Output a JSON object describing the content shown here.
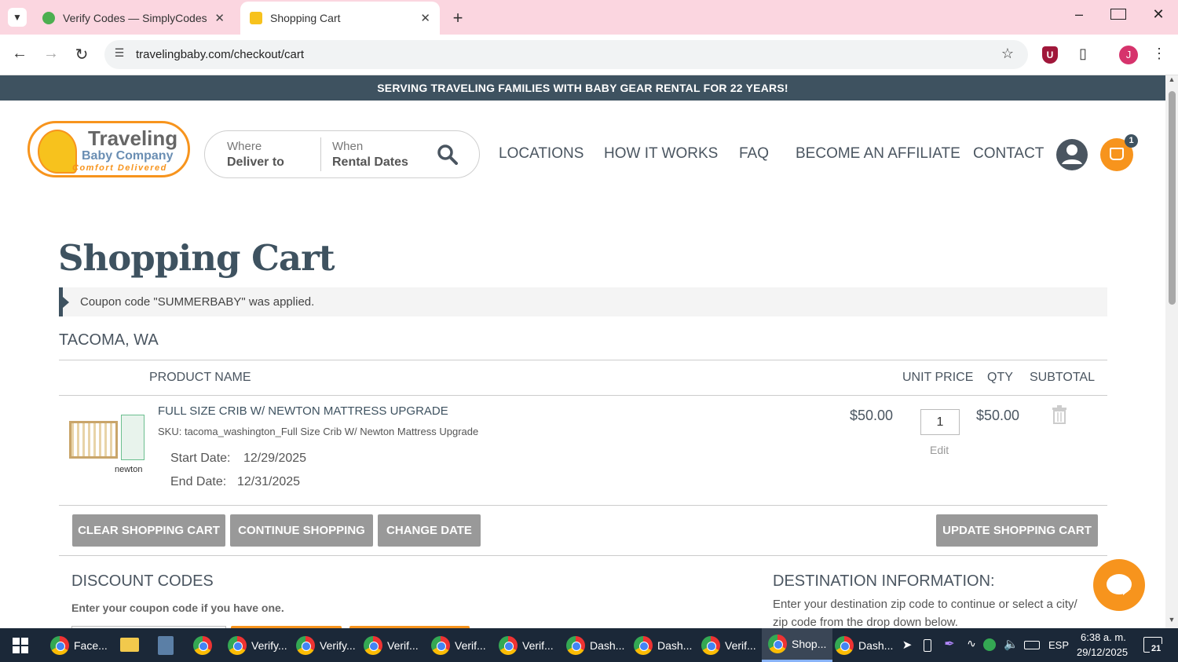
{
  "browser": {
    "tabs": [
      {
        "title": "Verify Codes — SimplyCodes"
      },
      {
        "title": "Shopping Cart"
      }
    ],
    "url": "travelingbaby.com/checkout/cart",
    "profile_initial": "J"
  },
  "site": {
    "banner": "SERVING TRAVELING FAMILIES WITH BABY GEAR RENTAL FOR 22 YEARS!",
    "logo": {
      "line1": "Traveling",
      "line2": "Baby Company",
      "line3": "Comfort Delivered"
    },
    "search": {
      "where_label": "Where",
      "where_value": "Deliver to",
      "when_label": "When",
      "when_value": "Rental Dates"
    },
    "nav": [
      "LOCATIONS",
      "HOW IT WORKS",
      "FAQ",
      "BECOME AN AFFILIATE",
      "CONTACT"
    ],
    "cart_count": "1"
  },
  "cart": {
    "title": "Shopping Cart",
    "notice": "Coupon code \"SUMMERBABY\" was applied.",
    "location": "TACOMA, WA",
    "headers": {
      "product": "PRODUCT NAME",
      "unit_price": "UNIT PRICE",
      "qty": "QTY",
      "subtotal": "SUBTOTAL"
    },
    "item": {
      "name": "FULL SIZE CRIB W/ NEWTON MATTRESS UPGRADE",
      "sku": "SKU: tacoma_washington_Full Size Crib W/ Newton Mattress Upgrade",
      "start_label": "Start Date:",
      "start_value": "12/29/2025",
      "end_label": "End Date:",
      "end_value": "12/31/2025",
      "unit_price": "$50.00",
      "qty": "1",
      "edit": "Edit",
      "subtotal": "$50.00",
      "brand": "newton"
    },
    "buttons": {
      "clear": "CLEAR SHOPPING CART",
      "continue": "CONTINUE SHOPPING",
      "change_date": "CHANGE DATE",
      "update": "UPDATE SHOPPING CART"
    },
    "discount": {
      "title": "DISCOUNT CODES",
      "text": "Enter your coupon code if you have one."
    },
    "destination": {
      "title": "DESTINATION INFORMATION:",
      "text1": "Enter your destination zip code to continue or select a city/",
      "text2": "zip code from the drop down below."
    }
  },
  "taskbar": {
    "apps": [
      "Face...",
      "Verify...",
      "Verify...",
      "Verif...",
      "Verif...",
      "Verif...",
      "Dash...",
      "Dash...",
      "Verif...",
      "Shop...",
      "Dash..."
    ],
    "lang": "ESP",
    "time": "6:38 a. m.",
    "date": "29/12/2025",
    "notif": "21"
  },
  "colors": {
    "banner": "#3e5260",
    "accent": "#f7941d",
    "button": "#999999",
    "tabbar": "#fbd6e0"
  }
}
